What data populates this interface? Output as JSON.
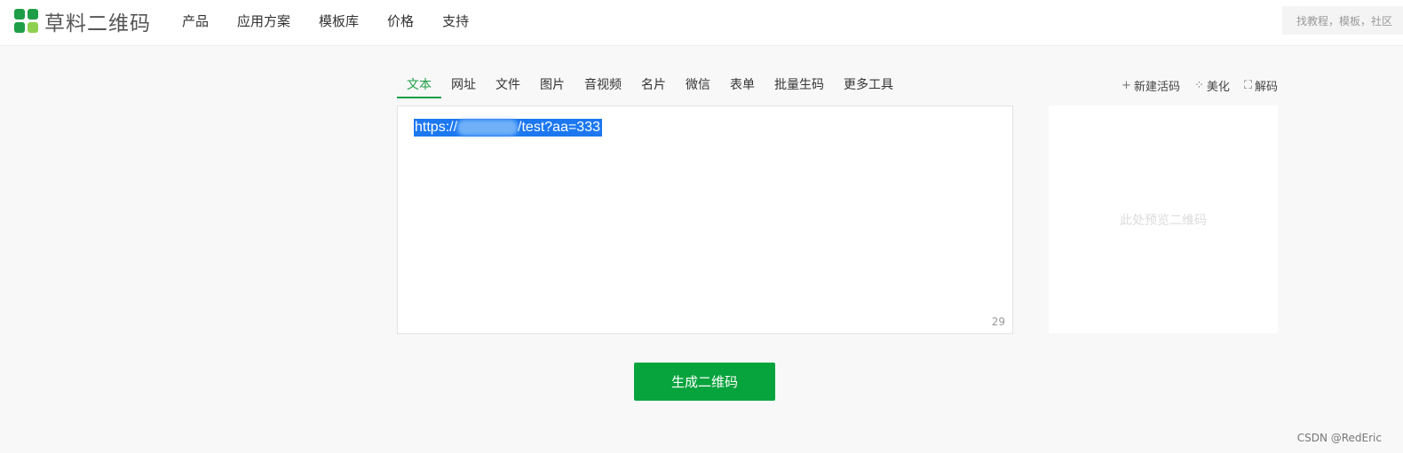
{
  "header": {
    "logo_text": "草料二维码",
    "nav": [
      "产品",
      "应用方案",
      "模板库",
      "价格",
      "支持"
    ],
    "search_placeholder": "找教程，模板，社区"
  },
  "tabs": {
    "items": [
      "文本",
      "网址",
      "文件",
      "图片",
      "音视频",
      "名片",
      "微信",
      "表单",
      "批量生码",
      "更多工具"
    ],
    "active": "文本"
  },
  "tools": {
    "new_live_code": "新建活码",
    "beautify": "美化",
    "decode": "解码",
    "new_live_code_icon": "plus-icon",
    "beautify_icon": "sparkle-icon",
    "decode_icon": "scan-icon"
  },
  "editor": {
    "text_prefix": "https://",
    "text_suffix": "/test?aa=333",
    "char_count": "29"
  },
  "preview": {
    "placeholder": "此处预览二维码"
  },
  "generate_button": "生成二维码",
  "watermark": "CSDN @RedEric",
  "colors": {
    "accent": "#1e9e46",
    "button": "#07a33d",
    "selection": "#1c78f0"
  }
}
